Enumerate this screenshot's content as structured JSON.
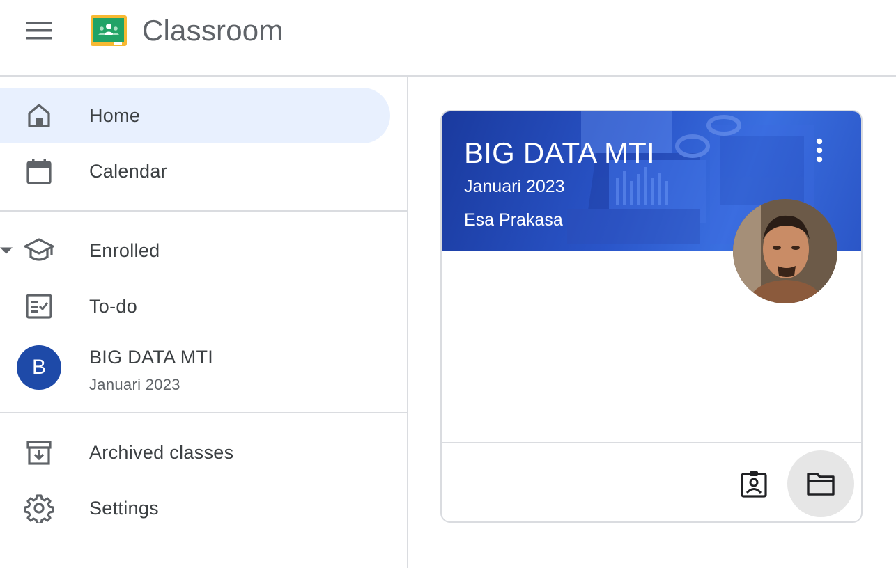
{
  "app": {
    "title": "Classroom"
  },
  "sidebar": {
    "items": [
      {
        "label": "Home",
        "icon": "home-icon",
        "active": true
      },
      {
        "label": "Calendar",
        "icon": "calendar-icon"
      },
      {
        "label": "Enrolled",
        "icon": "school-hat-icon"
      },
      {
        "label": "To-do",
        "icon": "todo-list-icon"
      },
      {
        "label": "Archived classes",
        "icon": "archive-icon"
      },
      {
        "label": "Settings",
        "icon": "gear-icon"
      }
    ],
    "enrolled_classes": [
      {
        "avatar_letter": "B",
        "name": "BIG DATA MTI",
        "section": "Januari 2023",
        "avatar_color": "#1e4aa8"
      }
    ]
  },
  "card": {
    "title": "BIG DATA MTI",
    "section": "Januari 2023",
    "teacher": "Esa Prakasa",
    "banner_color": "#2a55c9",
    "actions": [
      {
        "icon": "assignment-ind-icon"
      },
      {
        "icon": "folder-icon"
      }
    ]
  },
  "colors": {
    "active_nav_bg": "#e8f0fe",
    "divider": "#dadce0",
    "text": "#3c4043"
  }
}
